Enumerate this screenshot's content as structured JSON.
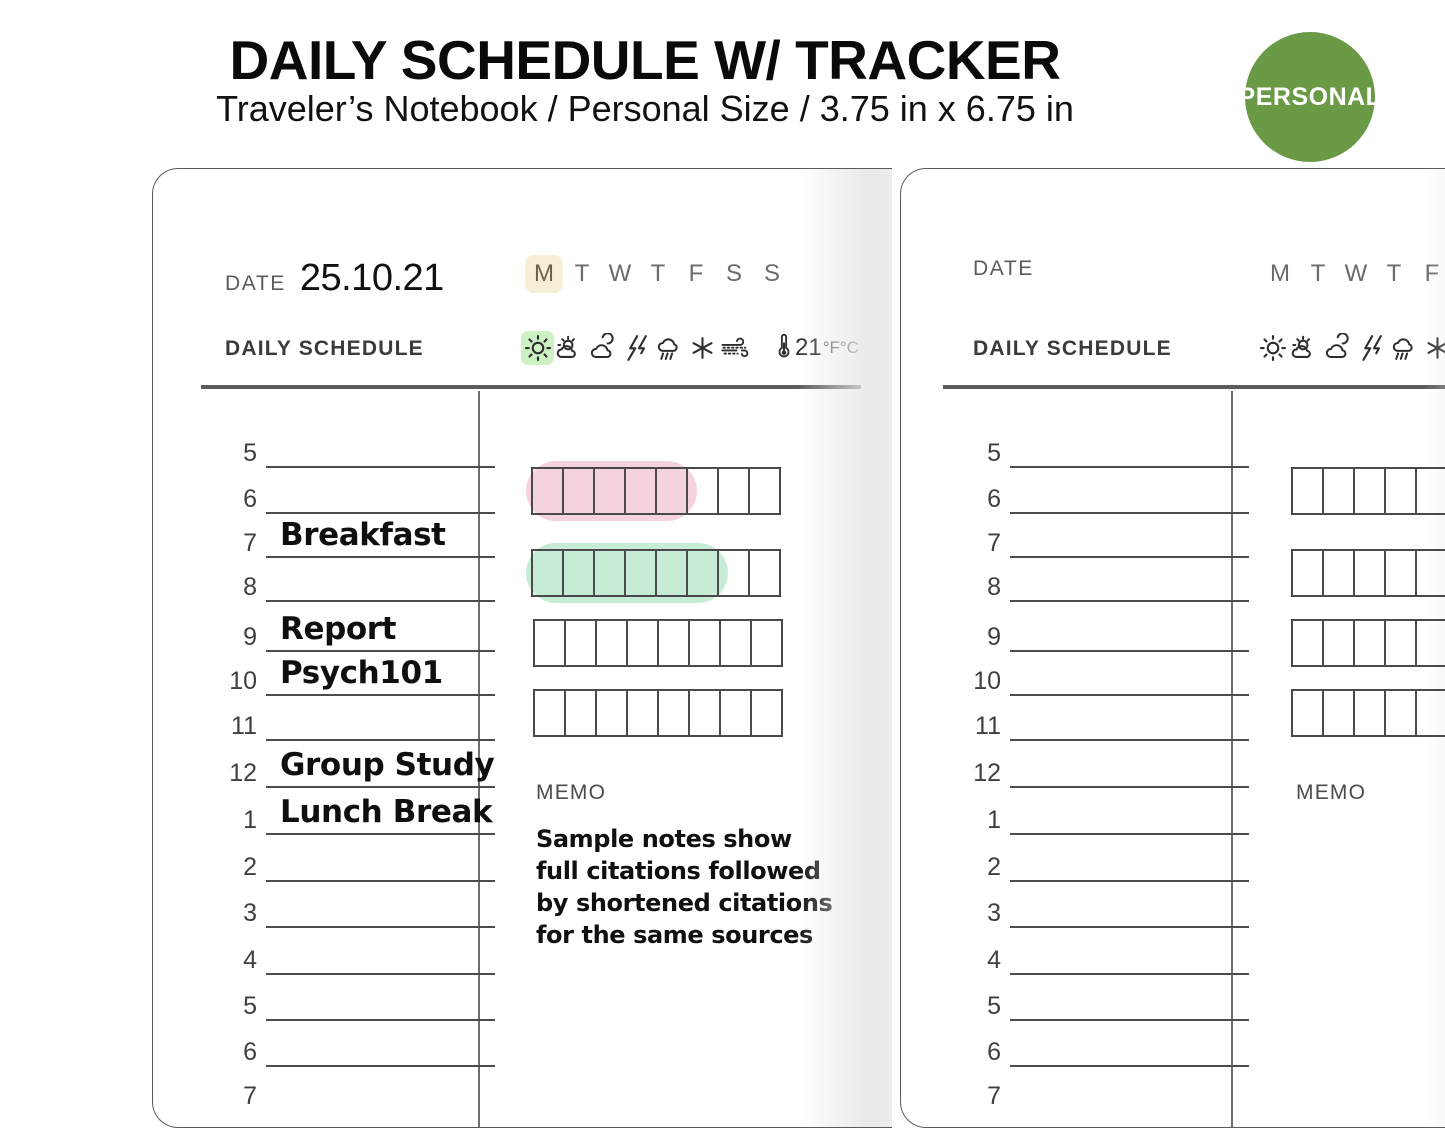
{
  "header": {
    "title": "DAILY SCHEDULE W/ TRACKER",
    "subtitle": "Traveler’s Notebook / Personal Size  /  3.75 in x 6.75 in",
    "badge_label": "PERSONAL",
    "badge_color": "#6a9a46"
  },
  "colors": {
    "ink": "#111111",
    "rule": "#5c5c5c",
    "box_border": "#4a4a4a",
    "tracker_pink": "#f5d3dd",
    "tracker_green": "#c6ecd5",
    "day_highlight": "#f6efd6",
    "weather_highlight": "#cdf0c4"
  },
  "labels": {
    "date": "DATE",
    "daily_schedule": "DAILY SCHEDULE",
    "memo": "MEMO"
  },
  "weekdays": [
    "M",
    "T",
    "W",
    "T",
    "F",
    "S",
    "S"
  ],
  "weather_icons": [
    "sun-icon",
    "partly-sunny-icon",
    "cloud-icon",
    "lightning-icon",
    "rain-icon",
    "snow-icon",
    "wind-icon"
  ],
  "temperature": {
    "value": "21",
    "units": "°F°C",
    "icon": "thermometer-icon"
  },
  "left_page": {
    "date_value": "25.10.21",
    "active_weekday_index": 0,
    "active_weather_index": 0,
    "hours": [
      {
        "num": "5",
        "entry": ""
      },
      {
        "num": "6",
        "entry": ""
      },
      {
        "num": "7",
        "entry": "Breakfast"
      },
      {
        "num": "8",
        "entry": ""
      },
      {
        "num": "9",
        "entry": "Report"
      },
      {
        "num": "10",
        "entry": "Psych101"
      },
      {
        "num": "11",
        "entry": ""
      },
      {
        "num": "12",
        "entry": "Group Study"
      },
      {
        "num": "1",
        "entry": "Lunch Break"
      },
      {
        "num": "2",
        "entry": ""
      },
      {
        "num": "3",
        "entry": ""
      },
      {
        "num": "4",
        "entry": ""
      },
      {
        "num": "5",
        "entry": ""
      },
      {
        "num": "6",
        "entry": ""
      },
      {
        "num": "7",
        "entry": ""
      }
    ],
    "trackers": [
      {
        "boxes": 8,
        "filled": 5,
        "color": "#f5d3dd"
      },
      {
        "boxes": 8,
        "filled": 6,
        "color": "#c6ecd5"
      },
      {
        "boxes": 8,
        "filled": 0,
        "color": ""
      },
      {
        "boxes": 8,
        "filled": 0,
        "color": ""
      }
    ],
    "memo_text": "Sample notes show full citations followed by shortened citations for the same sources"
  },
  "right_page": {
    "date_value": "",
    "active_weekday_index": -1,
    "active_weather_index": -1,
    "hours": [
      {
        "num": "5",
        "entry": ""
      },
      {
        "num": "6",
        "entry": ""
      },
      {
        "num": "7",
        "entry": ""
      },
      {
        "num": "8",
        "entry": ""
      },
      {
        "num": "9",
        "entry": ""
      },
      {
        "num": "10",
        "entry": ""
      },
      {
        "num": "11",
        "entry": ""
      },
      {
        "num": "12",
        "entry": ""
      },
      {
        "num": "1",
        "entry": ""
      },
      {
        "num": "2",
        "entry": ""
      },
      {
        "num": "3",
        "entry": ""
      },
      {
        "num": "4",
        "entry": ""
      },
      {
        "num": "5",
        "entry": ""
      },
      {
        "num": "6",
        "entry": ""
      },
      {
        "num": "7",
        "entry": ""
      }
    ],
    "trackers": [
      {
        "boxes": 8,
        "filled": 0,
        "color": ""
      },
      {
        "boxes": 8,
        "filled": 0,
        "color": ""
      },
      {
        "boxes": 8,
        "filled": 0,
        "color": ""
      },
      {
        "boxes": 8,
        "filled": 0,
        "color": ""
      }
    ],
    "memo_text": ""
  }
}
